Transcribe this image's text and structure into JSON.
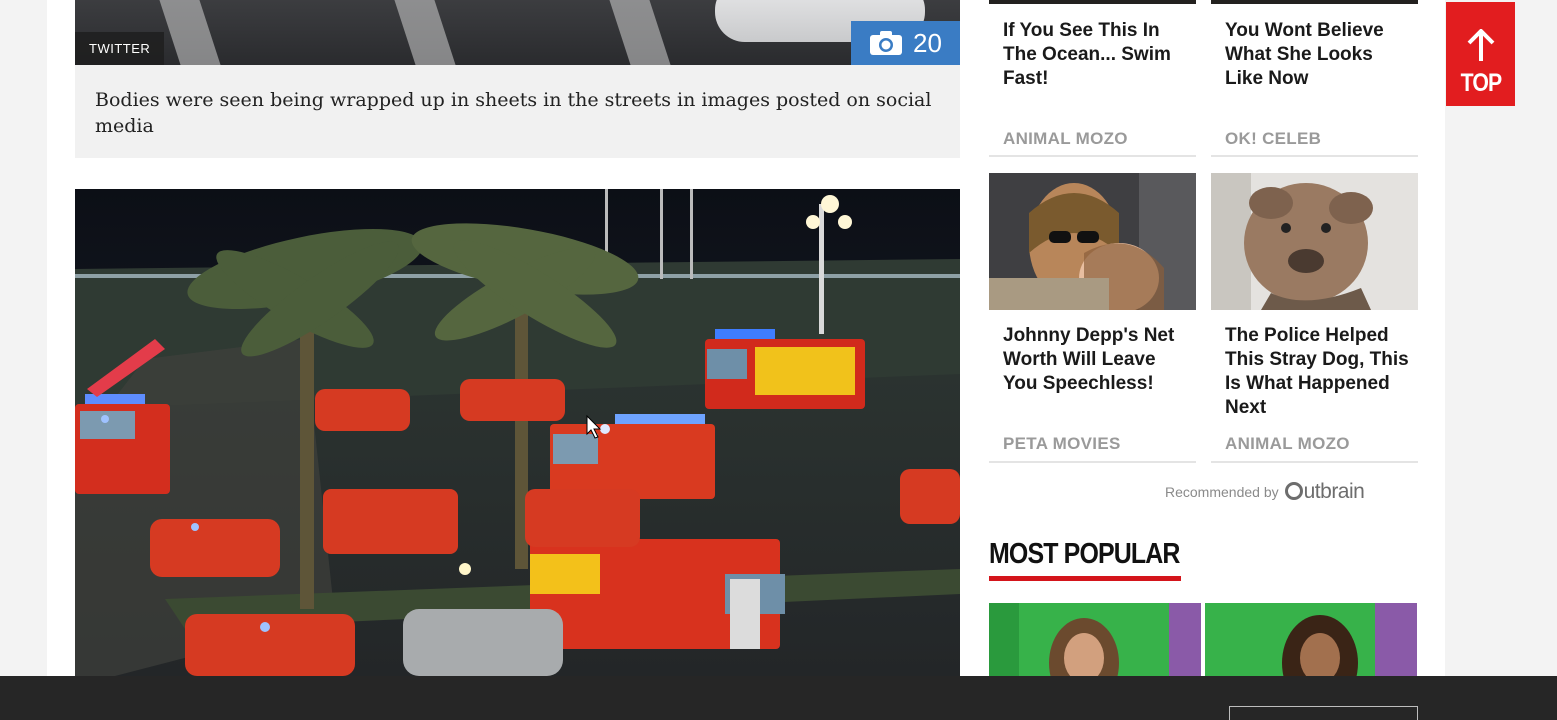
{
  "gallery": {
    "credit": "TWITTER",
    "photo_count": "20",
    "caption": "Bodies were seen being wrapped up in sheets in the streets in images posted on social media"
  },
  "recommended": {
    "cards": [
      {
        "title": "If You See This In The Ocean... Swim Fast!",
        "source": "ANIMAL MOZO"
      },
      {
        "title": "You Wont Believe What She Looks Like Now",
        "source": "OK! CELEB"
      },
      {
        "title": "Johnny Depp's Net Worth Will Leave You Speechless!",
        "source": "PETA MOVIES"
      },
      {
        "title": "The Police Helped This Stray Dog, This Is What Happened Next",
        "source": "ANIMAL MOZO"
      }
    ],
    "recommended_by": "Recommended by",
    "brand": "utbrain"
  },
  "most_popular": {
    "heading": "MOST POPULAR"
  },
  "back_to_top": {
    "label": "TOP"
  },
  "colors": {
    "accent_red": "#e21d1f",
    "gallery_blue": "#3a7cc4"
  }
}
